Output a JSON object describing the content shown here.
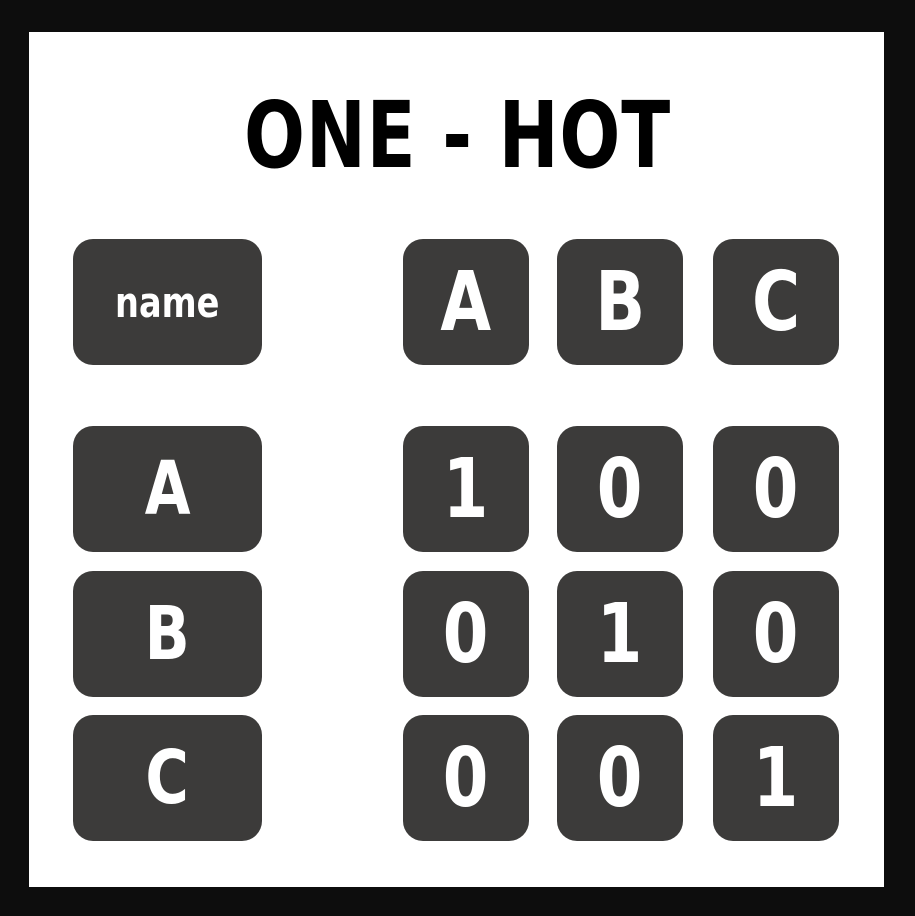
{
  "title": "ONE - HOT",
  "header": {
    "name_label": "name",
    "columns": [
      "A",
      "B",
      "C"
    ]
  },
  "rows": [
    {
      "label": "A",
      "values": [
        "1",
        "0",
        "0"
      ]
    },
    {
      "label": "B",
      "values": [
        "0",
        "1",
        "0"
      ]
    },
    {
      "label": "C",
      "values": [
        "0",
        "0",
        "1"
      ]
    }
  ],
  "colors": {
    "frame": "#0d0d0d",
    "background": "#ffffff",
    "tile": "#3c3b3a",
    "tile_text": "#ffffff",
    "title_text": "#000000"
  }
}
